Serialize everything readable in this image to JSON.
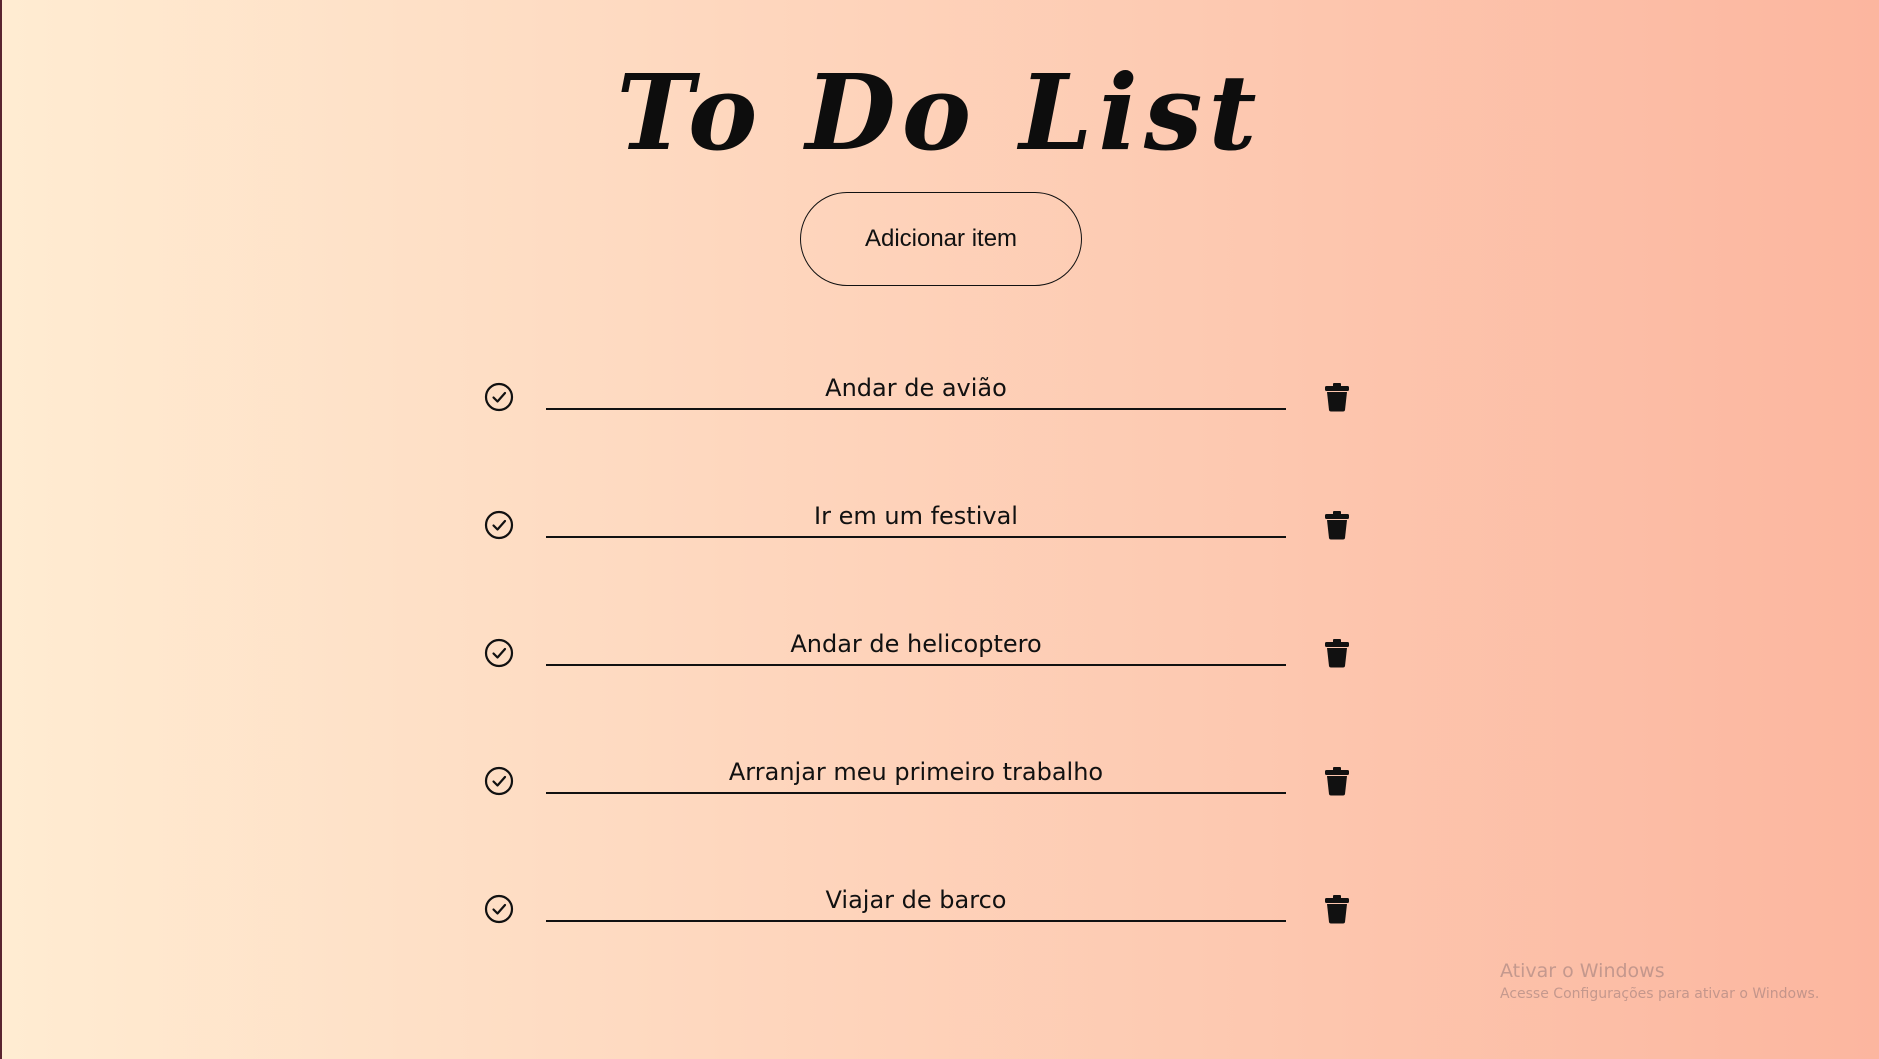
{
  "header": {
    "title": "To Do List",
    "add_button_label": "Adicionar item"
  },
  "todos": [
    {
      "text": "Andar de avião",
      "check_icon": "check-circle-icon",
      "delete_icon": "trash-icon"
    },
    {
      "text": "Ir em um festival",
      "check_icon": "check-circle-icon",
      "delete_icon": "trash-icon"
    },
    {
      "text": "Andar de helicoptero",
      "check_icon": "check-circle-icon",
      "delete_icon": "trash-icon"
    },
    {
      "text": "Arranjar meu primeiro trabalho",
      "check_icon": "check-circle-icon",
      "delete_icon": "trash-icon"
    },
    {
      "text": "Viajar de barco",
      "check_icon": "check-circle-icon",
      "delete_icon": "trash-icon"
    }
  ],
  "watermark": {
    "title": "Ativar o Windows",
    "subtitle": "Acesse Configurações para ativar o Windows."
  },
  "colors": {
    "gradient_start": "#ffecd2",
    "gradient_end": "#fcb69f",
    "text": "#111111"
  }
}
